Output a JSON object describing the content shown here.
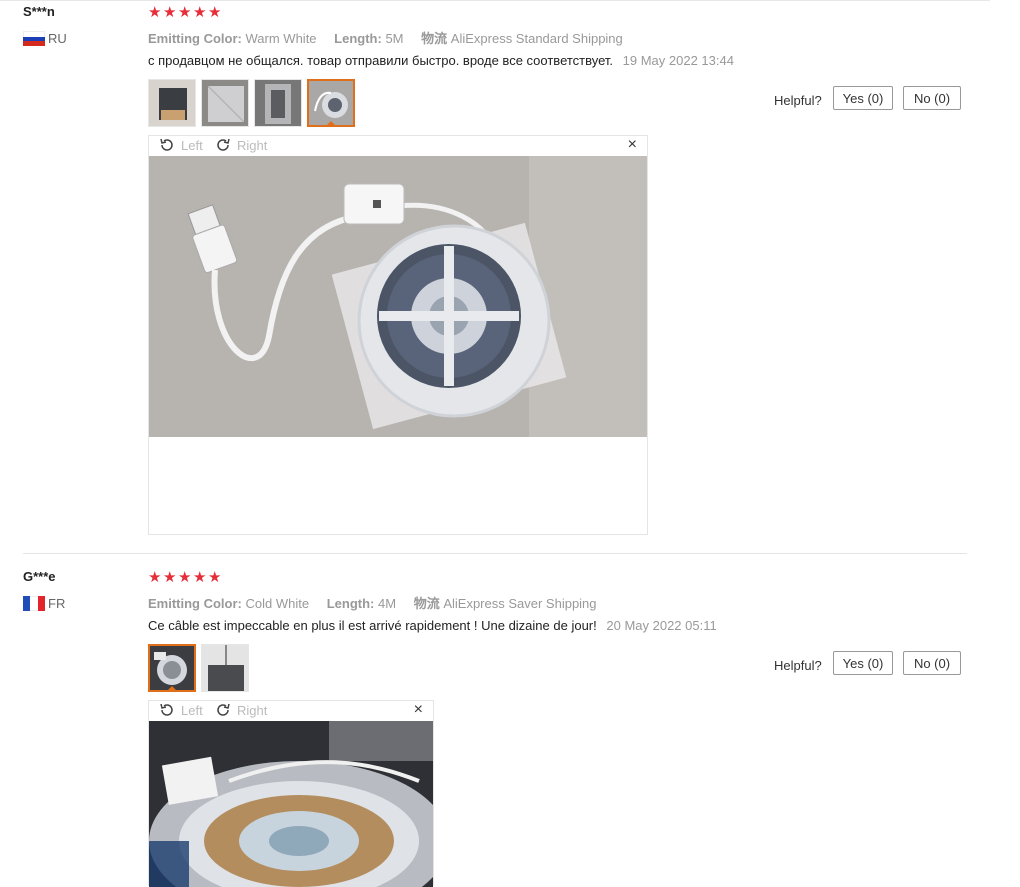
{
  "reviews": [
    {
      "user": "S***n",
      "country": "RU",
      "stars": 5,
      "attr_color_label": "Emitting Color:",
      "attr_color_value": "Warm White",
      "attr_length_label": "Length:",
      "attr_length_value": "5M",
      "attr_ship_label": "物流",
      "attr_ship_value": "AliExpress Standard Shipping",
      "text": "с продавцом не общался. товар отправили быстро. вроде все соответствует.",
      "date": "19 May 2022 13:44",
      "helpful_label": "Helpful?",
      "yes_label": "Yes (0)",
      "no_label": "No (0)",
      "rotate_left": "Left",
      "rotate_right": "Right",
      "close": "×"
    },
    {
      "user": "G***e",
      "country": "FR",
      "stars": 5,
      "attr_color_label": "Emitting Color:",
      "attr_color_value": "Cold White",
      "attr_length_label": "Length:",
      "attr_length_value": "4M",
      "attr_ship_label": "物流",
      "attr_ship_value": "AliExpress Saver Shipping",
      "text": "Ce câble est impeccable en plus il est arrivé rapidement ! Une dizaine de jour!",
      "date": "20 May 2022 05:11",
      "helpful_label": "Helpful?",
      "yes_label": "Yes (0)",
      "no_label": "No (0)",
      "rotate_left": "Left",
      "rotate_right": "Right",
      "close": "×"
    }
  ],
  "colors": {
    "star": "#e52e39",
    "accent": "#e06f1b"
  }
}
